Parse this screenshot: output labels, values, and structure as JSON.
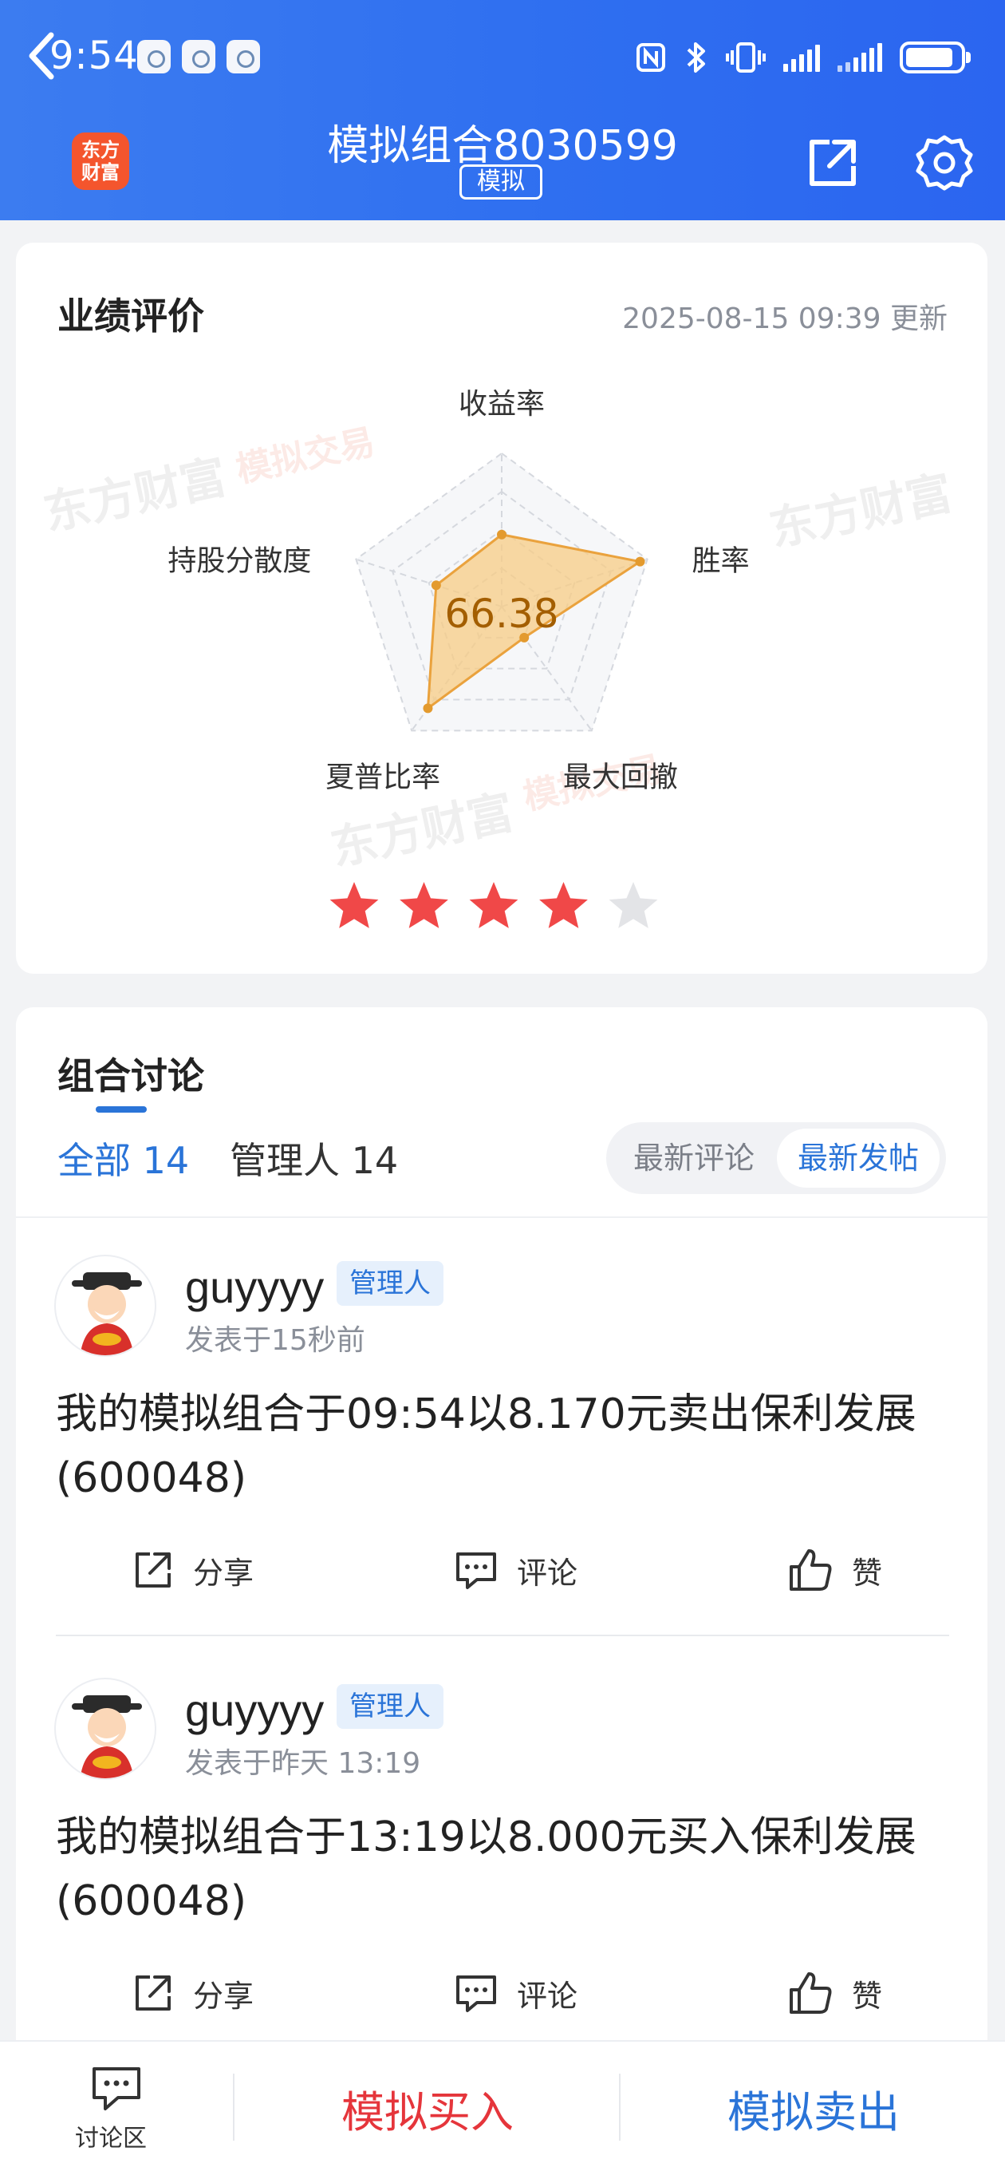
{
  "status_bar": {
    "time": "9:54"
  },
  "header": {
    "app_logo_line1": "东方",
    "app_logo_line2": "财富",
    "title": "模拟组合8030599",
    "tag": "模拟"
  },
  "performance": {
    "title": "业绩评价",
    "updated": "2025-08-15 09:39 更新",
    "score": "66.38",
    "axes": [
      "收益率",
      "胜率",
      "最大回撤",
      "夏普比率",
      "持股分散度"
    ],
    "axis_values": [
      0.47,
      0.95,
      0.25,
      0.82,
      0.45
    ],
    "stars": {
      "filled": 4,
      "total": 5
    },
    "watermark_brand": "东方财富",
    "watermark_tag": "模拟交易"
  },
  "discussion": {
    "title": "组合讨论",
    "tabs": [
      {
        "label": "全部 14",
        "active": true
      },
      {
        "label": "管理人 14",
        "active": false
      }
    ],
    "sort": [
      {
        "label": "最新评论",
        "active": false
      },
      {
        "label": "最新发帖",
        "active": true
      }
    ],
    "posts": [
      {
        "user": "guyyyy",
        "badge": "管理人",
        "time": "发表于15秒前",
        "text": "我的模拟组合于09:54以8.170元卖出保利发展(600048)",
        "actions": {
          "share": "分享",
          "comment": "评论",
          "like": "赞"
        }
      },
      {
        "user": "guyyyy",
        "badge": "管理人",
        "time": "发表于昨天 13:19",
        "text": "我的模拟组合于13:19以8.000元买入保利发展(600048)",
        "actions": {
          "share": "分享",
          "comment": "评论",
          "like": "赞"
        }
      }
    ]
  },
  "bottom_bar": {
    "discussion": "讨论区",
    "buy": "模拟买入",
    "sell": "模拟卖出"
  },
  "colors": {
    "header_blue": "#2f6ff0",
    "accent_blue": "#2a74d8",
    "buy_red": "#e5353b",
    "star_red": "#f04848",
    "radar_fill": "#f7cc84"
  }
}
